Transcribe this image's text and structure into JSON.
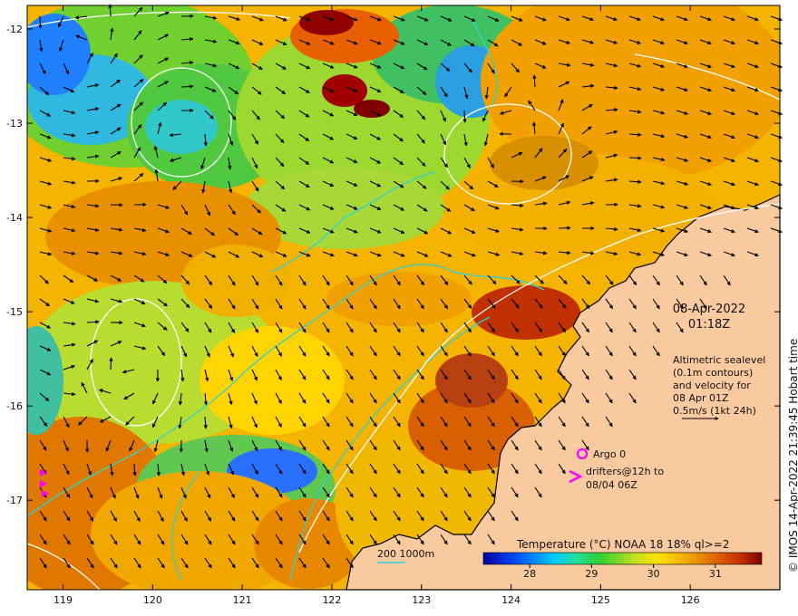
{
  "datetime": {
    "date": "08-Apr-2022",
    "time": "01:18Z"
  },
  "info": {
    "lines": [
      "Altimetric sealevel",
      "(0.1m contours)",
      "and velocity for",
      "08 Apr 01Z",
      "0.5m/s (1kt 24h)"
    ]
  },
  "legend": {
    "argo_label": "Argo 0",
    "drifters_line1": "drifters@12h to",
    "drifters_line2": "08/04 06Z",
    "isobath_label": "200  1000m"
  },
  "colorbar": {
    "title": "Temperature (°C) NOAA 18 18% ql>=2",
    "ticks": [
      "28",
      "29",
      "30",
      "31"
    ],
    "tick_values": [
      28,
      29,
      30,
      31
    ],
    "range": [
      27.25,
      31.75
    ]
  },
  "axes": {
    "x_labels": [
      "119",
      "120",
      "121",
      "122",
      "123",
      "124",
      "125",
      "126"
    ],
    "x_values": [
      119,
      120,
      121,
      122,
      123,
      124,
      125,
      126
    ],
    "xlim": [
      118.6,
      127.0
    ],
    "y_labels": [
      "-12",
      "-13",
      "-14",
      "-15",
      "-16",
      "-17"
    ],
    "y_values": [
      -12,
      -13,
      -14,
      -15,
      -16,
      -17
    ],
    "ylim": [
      -17.95,
      -11.75
    ]
  },
  "credit": "© IMOS 14-Apr-2022 21:39:45 Hobart time",
  "colors": {
    "land": "#f9c9a0",
    "isobath": "#2fd2d2",
    "contour": "#ffffff",
    "argo": "#ff00ff",
    "arrow": "#000000"
  }
}
